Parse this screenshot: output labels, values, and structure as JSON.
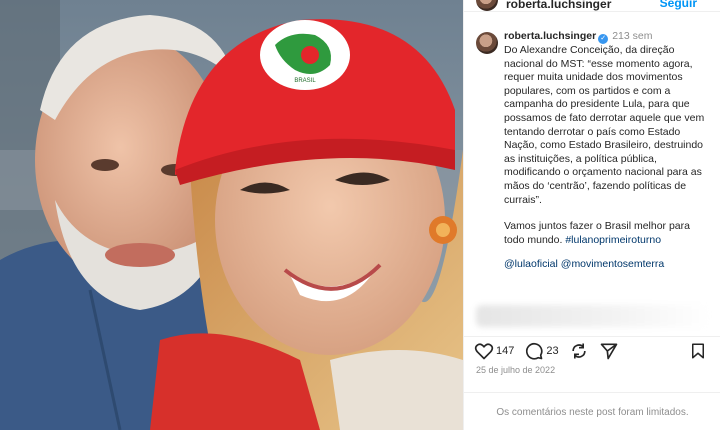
{
  "post": {
    "username": "roberta.luchsinger",
    "follow_label": "Seguir",
    "time_ago": "213 sem",
    "caption_paragraphs": [
      "Do Alexandre Conceição, da direção nacional do MST: “esse momento agora, requer muita unidade dos movimentos populares, com os partidos e com a campanha do presidente Lula, para que possamos de fato derrotar aquele que vem tentando derrotar o país como Estado Nação, como Estado Brasileiro, destruindo as instituições, a política pública, modificando o orçamento nacional para as mãos do ‘centrão’, fazendo políticas de currais”.",
      "Vamos juntos fazer o Brasil melhor para todo mundo."
    ],
    "hashtag": "#lulanoprimeiroturno",
    "mentions": [
      "@lulaoficial",
      "@movimentosemterra"
    ],
    "likes": "147",
    "comments": "23",
    "date": "25 de julho de 2022",
    "comments_limited": "Os comentários neste post foram limitados."
  },
  "photo": {
    "cap_badge_text": "BRASIL",
    "colors": {
      "cap_red": "#e3262b",
      "shirt_blue": "#3b5a87",
      "jacket_red": "#d7302b"
    }
  },
  "icons": [
    "heart-icon",
    "comment-icon",
    "share-icon",
    "repost-icon",
    "bookmark-icon",
    "verified-icon"
  ],
  "accent": "#0095f6"
}
